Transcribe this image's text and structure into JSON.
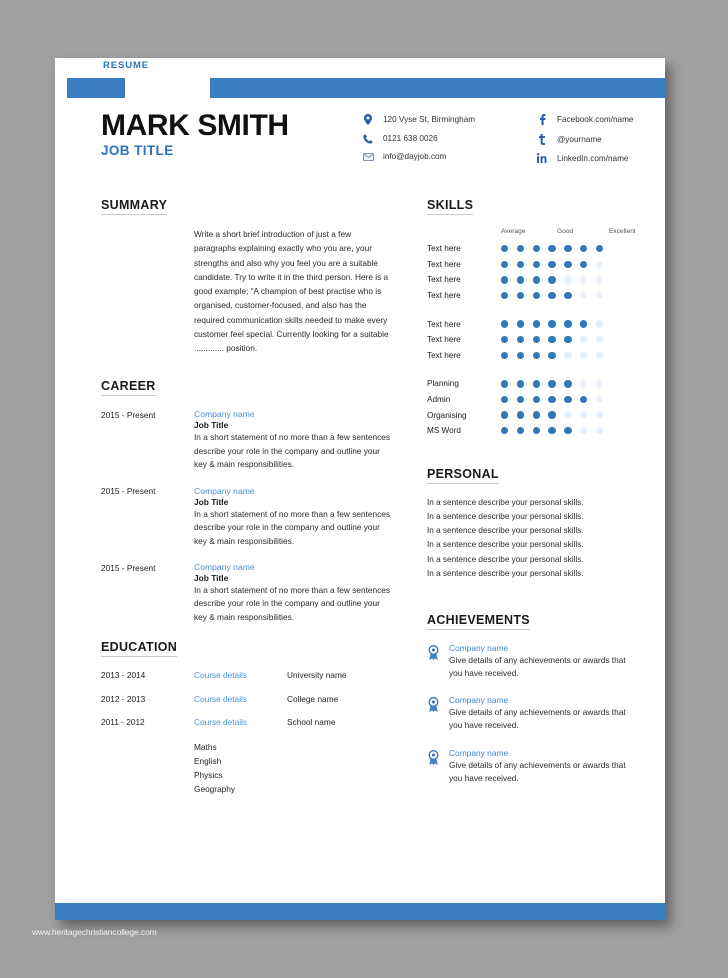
{
  "colors": {
    "accent": "#3a7dc0",
    "link": "#4a90d9",
    "dot_on": "#2f79bd",
    "dot_off": "#e5eff9"
  },
  "banner": {
    "tag": "RESUME"
  },
  "header": {
    "name": "MARK SMITH",
    "job_title": "JOB TITLE",
    "contacts_left": [
      {
        "icon": "location-pin-icon",
        "text": "120 Vyse St, Birmingham"
      },
      {
        "icon": "phone-icon",
        "text": "0121 638 0026"
      },
      {
        "icon": "envelope-icon",
        "text": "info@dayjob.com"
      }
    ],
    "contacts_right": [
      {
        "icon": "facebook-icon",
        "text": "Facebook.com/name"
      },
      {
        "icon": "twitter-icon",
        "text": "@yourname"
      },
      {
        "icon": "linkedin-icon",
        "text": "LinkedIn.com/name"
      }
    ]
  },
  "summary": {
    "heading": "SUMMARY",
    "body": "Write a short brief introduction of just a few paragraphs explaining exactly who you are, your strengths and also why you feel you are a suitable candidate. Try to write it in the third person. Here is a good example; “A champion of best practise who is organised, customer-focused, and also has the required communication skills needed to make every customer feel special. Currently looking for a suitable ............. position."
  },
  "career": {
    "heading": "CAREER",
    "items": [
      {
        "date": "2015 - Present",
        "company": "Company name",
        "role": "Job Title",
        "desc": "In a short statement of no more than a few sentences describe your role in the company and outline your key & main responsibilities."
      },
      {
        "date": "2015 - Present",
        "company": "Company name",
        "role": "Job Title",
        "desc": "In a short statement of no more than a few sentences describe your role in the company and outline your key & main responsibilities."
      },
      {
        "date": "2015 - Present",
        "company": "Company name",
        "role": "Job Title",
        "desc": "In a short statement of no more than a few sentences describe your role in the company and outline your key & main responsibilities."
      }
    ]
  },
  "education": {
    "heading": "EDUCATION",
    "items": [
      {
        "date": "2013 - 2014",
        "course": "Course details",
        "place": "University name"
      },
      {
        "date": "2012 - 2013",
        "course": "Course details",
        "place": "College name"
      },
      {
        "date": "2011 - 2012",
        "course": "Course details",
        "place": "School name"
      }
    ],
    "subjects": [
      "Maths",
      "English",
      "Physics",
      "Geography"
    ]
  },
  "skills": {
    "heading": "SKILLS",
    "legend": [
      "Average",
      "Good",
      "Excellent"
    ],
    "max_dots": 7,
    "groups": [
      [
        {
          "label": "Text here",
          "value": 7
        },
        {
          "label": "Text here",
          "value": 6
        },
        {
          "label": "Text here",
          "value": 4
        },
        {
          "label": "Text here",
          "value": 5
        }
      ],
      [
        {
          "label": "Text here",
          "value": 6
        },
        {
          "label": "Text here",
          "value": 5
        },
        {
          "label": "Text here",
          "value": 4
        }
      ],
      [
        {
          "label": "Planning",
          "value": 5
        },
        {
          "label": "Admin",
          "value": 6
        },
        {
          "label": "Organising",
          "value": 4
        },
        {
          "label": "MS Word",
          "value": 5
        }
      ]
    ]
  },
  "personal": {
    "heading": "PERSONAL",
    "lines": [
      "In a sentence describe your personal skills.",
      "In a sentence describe your personal skills.",
      "In a sentence describe your personal skills.",
      "In a sentence describe your personal skills.",
      "In a sentence describe your personal skills.",
      "In a sentence describe your personal skills."
    ]
  },
  "achievements": {
    "heading": "ACHIEVEMENTS",
    "items": [
      {
        "icon": "award-ribbon-icon",
        "company": "Company name",
        "text": "Give details of any achievements or awards that you have received."
      },
      {
        "icon": "award-ribbon-icon",
        "company": "Company name",
        "text": "Give details of any achievements or awards that you have received."
      },
      {
        "icon": "award-ribbon-icon",
        "company": "Company name",
        "text": "Give details of any achievements or awards that you have received."
      }
    ]
  },
  "watermark": {
    "text": "www.heritagechristiancollege.com"
  }
}
